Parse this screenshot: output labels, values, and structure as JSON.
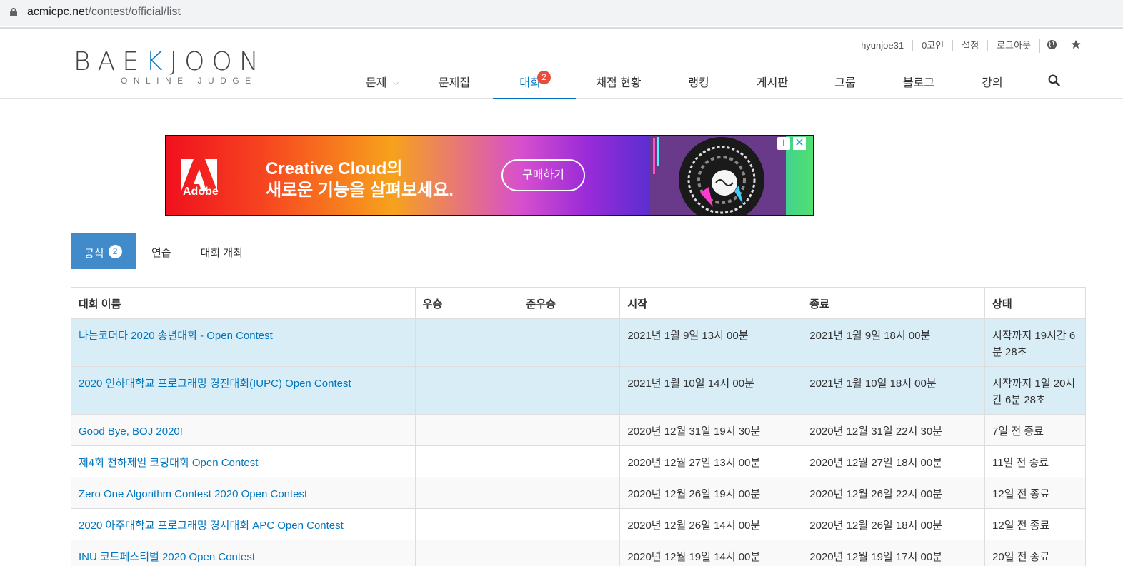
{
  "browser": {
    "url_host": "acmicpc.net",
    "url_path": "/contest/official/list"
  },
  "logo": {
    "main_before": "BAE",
    "main_k": "K",
    "main_after": "JOON",
    "sub": "ONLINE JUDGE"
  },
  "toplinks": {
    "user": "hyunjoe31",
    "coins": "0코인",
    "settings": "설정",
    "logout": "로그아웃",
    "globe_icon": "globe-icon",
    "star_icon": "star-icon"
  },
  "nav": {
    "problems": "문제",
    "workbook": "문제집",
    "contest": "대회",
    "contest_badge": "2",
    "status": "채점 현황",
    "ranking": "랭킹",
    "board": "게시판",
    "group": "그룹",
    "blog": "블로그",
    "lecture": "강의",
    "search_icon": "search-icon"
  },
  "ad": {
    "brand": "Adobe",
    "line1": "Creative Cloud의",
    "line2": "새로운 기능을 살펴보세요.",
    "button": "구매하기",
    "adchoices": "i",
    "close": "✕"
  },
  "tabs": {
    "official": "공식",
    "official_count": "2",
    "practice": "연습",
    "host": "대회 개최"
  },
  "table": {
    "headers": [
      "대회 이름",
      "우승",
      "준우승",
      "시작",
      "종료",
      "상태"
    ],
    "rows": [
      {
        "name": "나는코더다 2020 송년대회 - Open Contest",
        "winner": "",
        "runner": "",
        "start": "2021년 1월 9일 13시 00분",
        "end": "2021년 1월 9일 18시 00분",
        "state": "시작까지 19시간 6분 28초",
        "kind": "up"
      },
      {
        "name": "2020 인하대학교 프로그래밍 경진대회(IUPC) Open Contest",
        "winner": "",
        "runner": "",
        "start": "2021년 1월 10일 14시 00분",
        "end": "2021년 1월 10일 18시 00분",
        "state": "시작까지 1일 20시간 6분 28초",
        "kind": "up"
      },
      {
        "name": "Good Bye, BOJ 2020!",
        "winner": "",
        "runner": "",
        "start": "2020년 12월 31일 19시 30분",
        "end": "2020년 12월 31일 22시 30분",
        "state": "7일 전 종료",
        "kind": "past"
      },
      {
        "name": "제4회 천하제일 코딩대회 Open Contest",
        "winner": "",
        "runner": "",
        "start": "2020년 12월 27일 13시 00분",
        "end": "2020년 12월 27일 18시 00분",
        "state": "11일 전 종료",
        "kind": "past"
      },
      {
        "name": "Zero One Algorithm Contest 2020 Open Contest",
        "winner": "",
        "runner": "",
        "start": "2020년 12월 26일 19시 00분",
        "end": "2020년 12월 26일 22시 00분",
        "state": "12일 전 종료",
        "kind": "past"
      },
      {
        "name": "2020 아주대학교 프로그래밍 경시대회 APC Open Contest",
        "winner": "",
        "runner": "",
        "start": "2020년 12월 26일 14시 00분",
        "end": "2020년 12월 26일 18시 00분",
        "state": "12일 전 종료",
        "kind": "past"
      },
      {
        "name": "INU 코드페스티벌 2020 Open Contest",
        "winner": "",
        "runner": "",
        "start": "2020년 12월 19일 14시 00분",
        "end": "2020년 12월 19일 17시 00분",
        "state": "20일 전 종료",
        "kind": "past"
      }
    ]
  },
  "colors": {
    "accent": "#0076c0",
    "tab_active": "#428bca",
    "badge": "#e74c3c",
    "upcoming_row": "#d9edf7"
  }
}
